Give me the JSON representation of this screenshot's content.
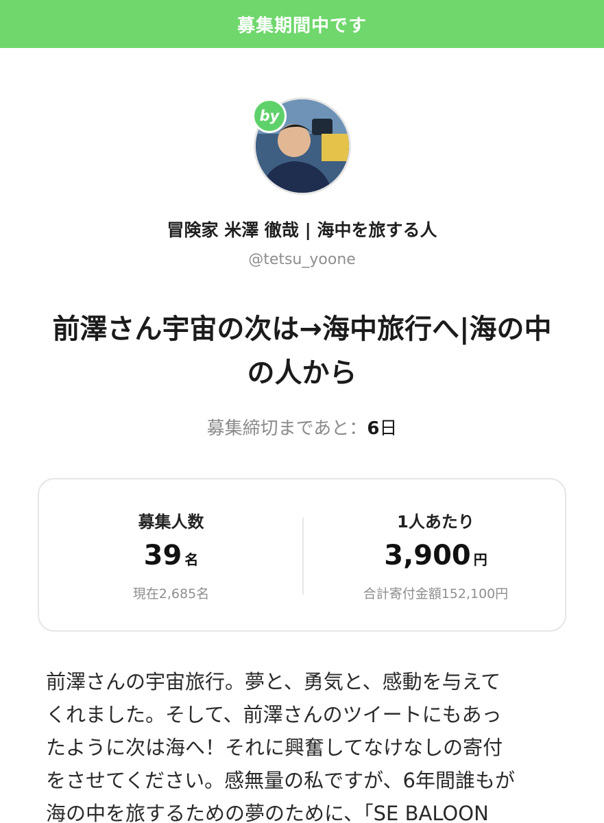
{
  "banner": {
    "text": "募集期間中です"
  },
  "author": {
    "badge": "by",
    "name": "冒険家 米澤 徹哉 | 海中を旅する人",
    "handle": "@tetsu_yoone"
  },
  "project": {
    "title": "前澤さん宇宙の次は→海中旅行へ|海の中の人から"
  },
  "deadline": {
    "label": "募集締切まであと：",
    "value": "6",
    "unit": "日"
  },
  "stats": {
    "recruit": {
      "label": "募集人数",
      "value": "39",
      "unit": "名",
      "sub": "現在2,685名"
    },
    "per_person": {
      "label": "1人あたり",
      "value": "3,900",
      "unit": "円",
      "sub": "合計寄付金額152,100円"
    }
  },
  "body": {
    "text": "前澤さんの宇宙旅行。夢と、勇気と、感動を与えて\nくれました。そして、前澤さんのツイートにもあっ\nたように次は海へ！それに興奮してなけなしの寄付\nをさせてください。感無量の私ですが、6年間誰もが\n海の中を旅するための夢のために、「SE BALOON"
  },
  "colors": {
    "accent_green": "#6fd76c",
    "badge_green": "#5fd16a"
  },
  "icons": {
    "badge": "by-badge",
    "avatar": "profile-photo"
  }
}
